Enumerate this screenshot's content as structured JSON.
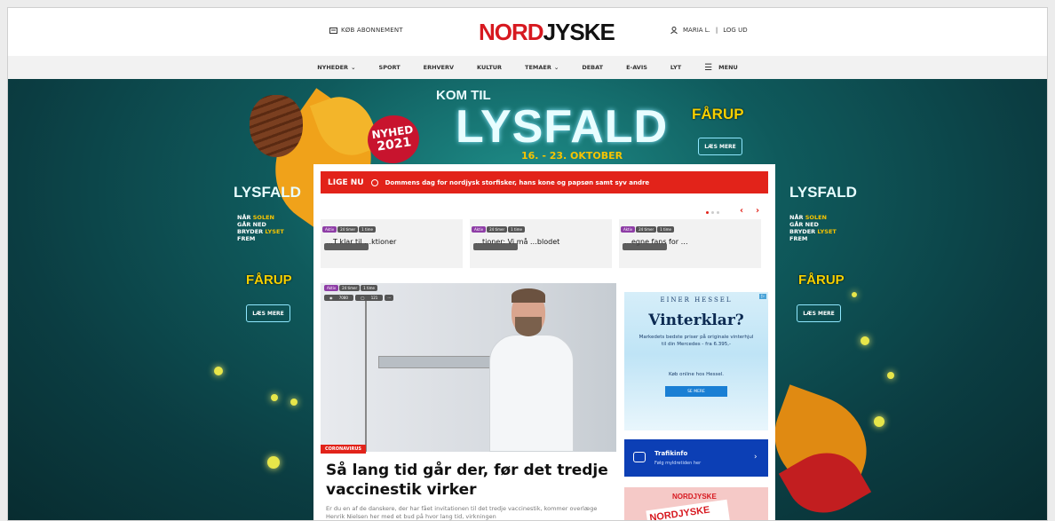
{
  "header": {
    "subscribe": "KØB ABONNEMENT",
    "logo_red": "NORD",
    "logo_dark": "JYSKE",
    "user": "MARIA L.",
    "separator": "|",
    "logout": "LOG UD"
  },
  "nav": [
    {
      "label": "NYHEDER",
      "dropdown": true
    },
    {
      "label": "SPORT"
    },
    {
      "label": "ERHVERV"
    },
    {
      "label": "KULTUR"
    },
    {
      "label": "TEMAER",
      "dropdown": true
    },
    {
      "label": "DEBAT"
    },
    {
      "label": "E-AVIS"
    },
    {
      "label": "LYT"
    },
    {
      "label": "MENU",
      "icon": "hamburger-icon"
    }
  ],
  "banner": {
    "kom_til": "KOM TIL",
    "title": "LYSFALD",
    "dates": "16. - 23. OKTOBER",
    "badge_line1": "NYHED",
    "badge_line2": "2021",
    "sponsor": "FÅRUP",
    "cta": "LÆS MERE"
  },
  "side_ad": {
    "title": "LYSFALD",
    "line1a": "NÅR ",
    "line1b": "SOLEN",
    "line2": "GÅR NED",
    "line3a": "BRYDER ",
    "line3b": "LYSET",
    "line4": "FREM",
    "sponsor": "FÅRUP",
    "cta": "LÆS MERE"
  },
  "live": {
    "label": "LIGE NU",
    "headline": "Dommens dag for nordjysk storfisker, hans kone og papsøn samt syv andre"
  },
  "carousel": {
    "cards": [
      {
        "tag": "Aktiv",
        "age": "24 timer",
        "dur": "1 time",
        "title": "…T klar til …ktioner"
      },
      {
        "tag": "Aktiv",
        "age": "24 timer",
        "dur": "1 time",
        "title": "…tioner: Vi må …blodet"
      },
      {
        "tag": "Aktiv",
        "age": "24 timer",
        "dur": "1 time",
        "title": "…egne fans for …"
      }
    ],
    "prev": "‹",
    "next": "›"
  },
  "hero": {
    "tag": "Aktiv",
    "age": "24 timer",
    "dur": "1 time",
    "views": "7080",
    "comments": "121",
    "more": "···",
    "category": "CORONAVIRUS",
    "headline": "Så lang tid går der, før det tredje vaccinestik virker",
    "teaser": "Er du en af de danskere, der har fået invitationen til det tredje vaccinestik, kommer overlæge Henrik Nielsen her med et bud på hvor lang tid, virkningen"
  },
  "ad": {
    "brand": "EINER HESSEL",
    "headline": "Vinterklar?",
    "body": "Markedets bedste priser på originale vinterhjul til din Mercedes - fra 6.395,-",
    "sub": "Køb online hos Hessel.",
    "button": "SE MERE",
    "choice": "▷"
  },
  "traffic": {
    "title": "Trafikinfo",
    "subtitle": "Følg myldretiden her",
    "arrow": "›"
  },
  "paper": {
    "logo": "NORDJYSKE",
    "cover": "NORDJYSKE"
  },
  "colors": {
    "brand_red": "#d71920",
    "live_red": "#e2231a",
    "traffic_blue": "#0c3fb5",
    "teal": "#0f5a5c",
    "yellow": "#f7c400"
  }
}
